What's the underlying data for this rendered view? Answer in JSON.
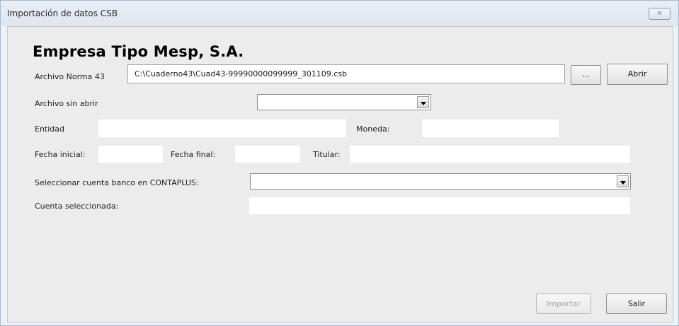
{
  "window": {
    "title": "Importación de datos CSB",
    "close_glyph": "✕"
  },
  "company_name": "Empresa Tipo Mesp, S.A.",
  "archivo": {
    "label": "Archivo Norma 43",
    "value": "C:\\Cuaderno43\\Cuad43-99990000099999_301109.csb",
    "browse_label": "...",
    "open_label": "Abrir"
  },
  "archivo_sin_abrir": {
    "label": "Archivo sin abrir",
    "selected": ""
  },
  "entidad": {
    "label": "Entidad",
    "value": ""
  },
  "moneda": {
    "label": "Moneda:",
    "value": ""
  },
  "fecha_inicial": {
    "label": "Fecha inicial:",
    "value": ""
  },
  "fecha_final": {
    "label": "Fecha final:",
    "value": ""
  },
  "titular": {
    "label": "Titular:",
    "value": ""
  },
  "cuenta_banco": {
    "label": "Seleccionar cuenta banco en CONTAPLUS:",
    "selected": ""
  },
  "cuenta_seleccionada": {
    "label": "Cuenta seleccionada:",
    "value": ""
  },
  "footer": {
    "import_label": "Importar",
    "exit_label": "Salir"
  },
  "icons": {
    "close": "close-icon",
    "dropdown": "chevron-down-icon"
  }
}
